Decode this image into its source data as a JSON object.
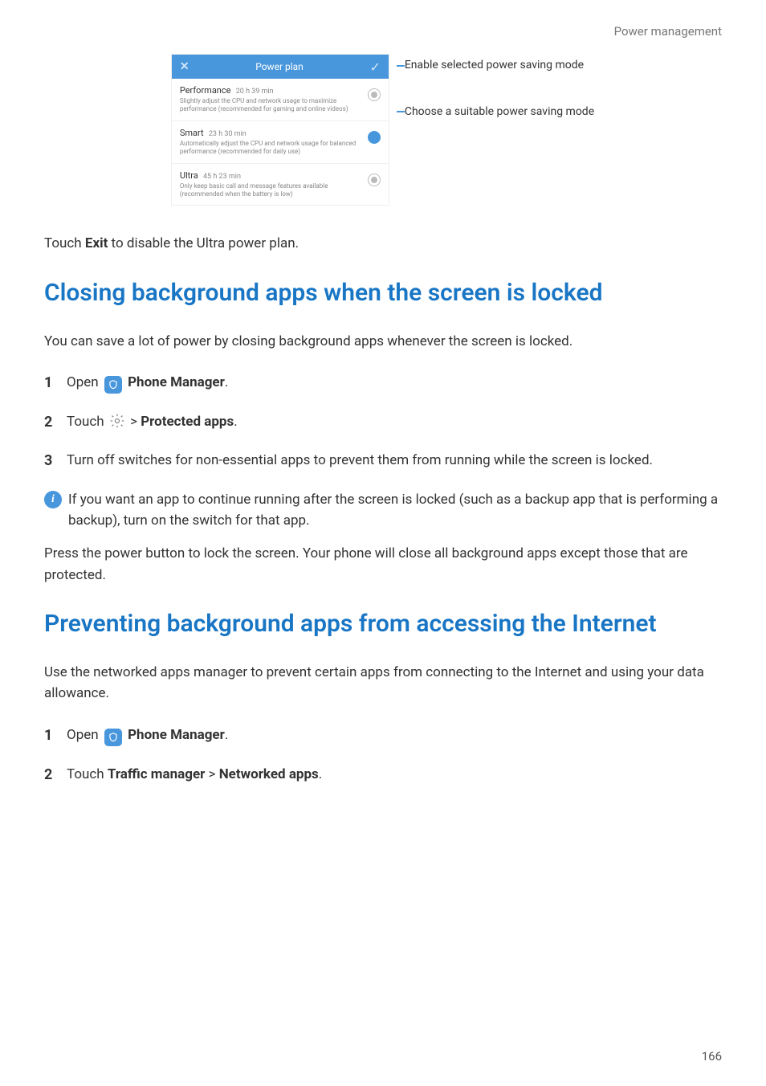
{
  "header": {
    "section_label": "Power management"
  },
  "footer": {
    "page_number": "166"
  },
  "screenshot": {
    "title": "Power plan",
    "options": [
      {
        "name": "Performance",
        "time": "20 h 39 min",
        "desc": "Slightly adjust the CPU and network usage to maximize performance (recommended for gaming and online videos)"
      },
      {
        "name": "Smart",
        "time": "23 h 30 min",
        "desc": "Automatically adjust the CPU and network usage for balanced performance (recommended for daily use)"
      },
      {
        "name": "Ultra",
        "time": "45 h 23 min",
        "desc": "Only keep basic call and message features available (recommended when the battery is low)"
      }
    ],
    "callouts": {
      "enable": "Enable selected power saving mode",
      "choose": "Choose a suitable power saving mode"
    }
  },
  "para_exit_prefix": "Touch ",
  "para_exit_bold": "Exit",
  "para_exit_suffix": " to disable the Ultra power plan.",
  "section1": {
    "title": "Closing background apps when the screen is locked",
    "intro": "You can save a lot of power by closing background apps whenever the screen is locked.",
    "step1_prefix": "Open ",
    "step1_bold": "Phone Manager",
    "step2_prefix": "Touch ",
    "step2_gt": " > ",
    "step2_bold": "Protected apps",
    "step3": "Turn off switches for non-essential apps to prevent them from running while the screen is locked.",
    "tip": "If you want an app to continue running after the screen is locked (such as a backup app that is performing a backup), turn on the switch for that app.",
    "para_after": "Press the power button to lock the screen. Your phone will close all background apps except those that are protected."
  },
  "section2": {
    "title": "Preventing background apps from accessing the Internet",
    "intro": "Use the networked apps manager to prevent certain apps from connecting to the Internet and using your data allowance.",
    "step1_prefix": "Open ",
    "step1_bold": "Phone Manager",
    "step2_prefix": "Touch ",
    "step2_bold1": "Traffic manager",
    "step2_gt": " > ",
    "step2_bold2": "Networked apps"
  },
  "chart_data": {
    "type": "table",
    "title": "Power plan options (estimated battery time)",
    "series": [
      {
        "name": "Performance",
        "value_text": "20 h 39 min"
      },
      {
        "name": "Smart",
        "value_text": "23 h 30 min"
      },
      {
        "name": "Ultra",
        "value_text": "45 h 23 min"
      }
    ]
  }
}
